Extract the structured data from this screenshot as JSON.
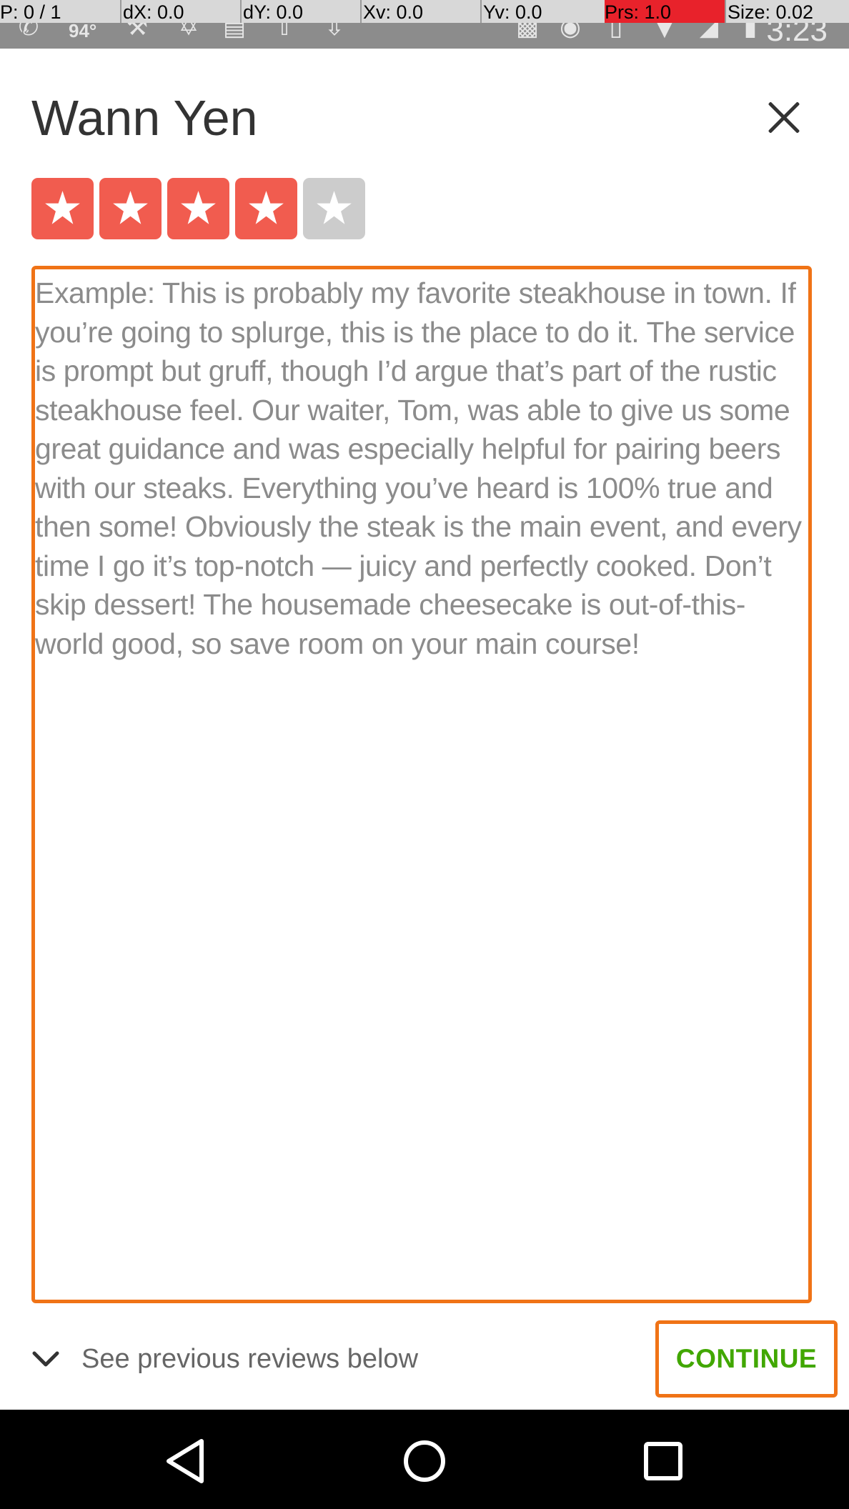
{
  "status_bar": {
    "temperature": "94°",
    "time": "3:23",
    "debug": {
      "pointer": "P: 0 / 1",
      "dx": "dX: 0.0",
      "dy": "dY: 0.0",
      "xv": "Xv: 0.0",
      "yv": "Yv: 0.0",
      "prs": "Prs: 1.0",
      "size": "Size: 0.02"
    },
    "icons_left": [
      "phone-missed-icon",
      "hammer-icon",
      "pinwheel-icon",
      "image-icon",
      "upload-icon",
      "download-icon"
    ],
    "icons_right": [
      "cast-icon",
      "location-icon",
      "vibrate-icon",
      "wifi-icon",
      "signal-icon",
      "battery-icon"
    ]
  },
  "header": {
    "title": "Wann Yen",
    "close_icon": "close-icon"
  },
  "rating": {
    "value": 4,
    "max": 5,
    "active_color": "#f15c4f",
    "inactive_color": "#cccccc"
  },
  "review": {
    "placeholder": "Example: This is probably my favorite steakhouse in town. If you’re going to splurge, this is the place to do it. The service is prompt but gruff, though I’d argue that’s part of the rustic steakhouse feel. Our waiter, Tom, was able to give us some great guidance and was especially helpful for pairing beers with our steaks. Everything you’ve heard is 100% true and then some! Obviously the steak is the main event, and every time I go it’s top-notch — juicy and perfectly cooked. Don’t skip dessert! The housemade cheesecake is out-of-this-world good, so save room on your main course!",
    "value": ""
  },
  "footer": {
    "previous_label": "See previous reviews below",
    "continue_label": "CONTINUE",
    "accent_color": "#f07316",
    "continue_color": "#41a700"
  },
  "nav_bar": {
    "back_icon": "back-icon",
    "home_icon": "home-icon",
    "recents_icon": "recents-icon"
  }
}
